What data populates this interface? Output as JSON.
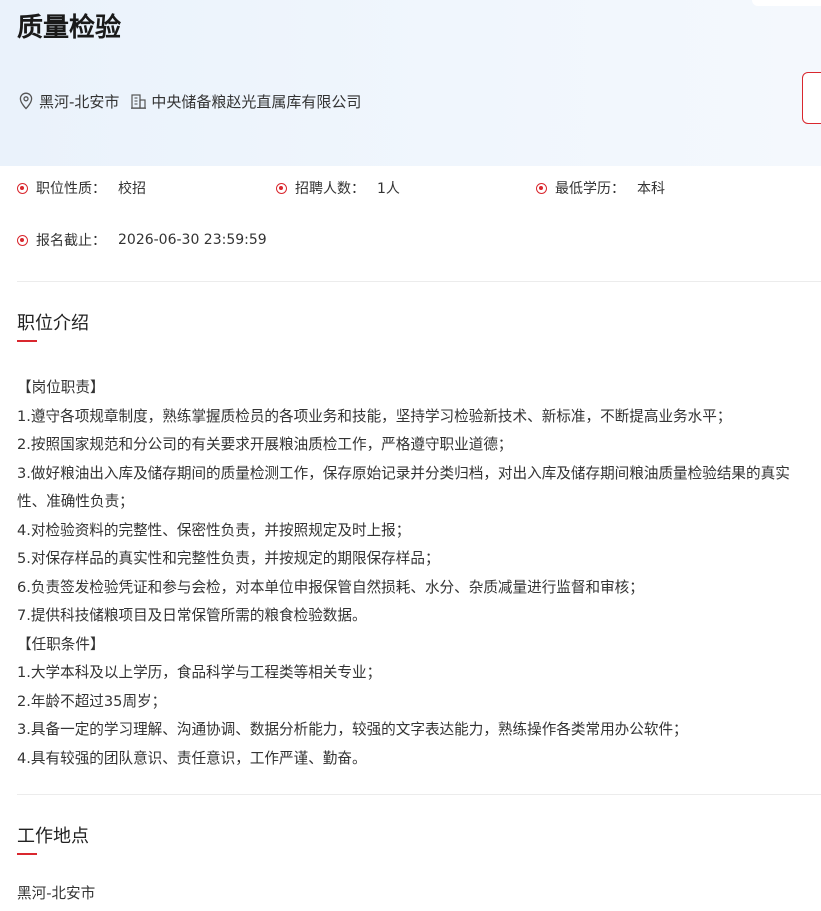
{
  "job": {
    "title": "质量检验",
    "location": "黑河-北安市",
    "company": "中央储备粮赵光直属库有限公司"
  },
  "attributes": [
    {
      "label": "职位性质：",
      "value": "校招"
    },
    {
      "label": "招聘人数：",
      "value": "1人"
    },
    {
      "label": "最低学历：",
      "value": "本科"
    },
    {
      "label": "报名截止：",
      "value": "2026-06-30 23:59:59"
    }
  ],
  "sections": {
    "intro_title": "职位介绍",
    "location_title": "工作地点"
  },
  "description": [
    "【岗位职责】",
    "1.遵守各项规章制度，熟练掌握质检员的各项业务和技能，坚持学习检验新技术、新标准，不断提高业务水平；",
    "2.按照国家规范和分公司的有关要求开展粮油质检工作，严格遵守职业道德；",
    "3.做好粮油出入库及储存期间的质量检测工作，保存原始记录并分类归档，对出入库及储存期间粮油质量检验结果的真实性、准确性负责；",
    "4.对检验资料的完整性、保密性负责，并按照规定及时上报；",
    "5.对保存样品的真实性和完整性负责，并按规定的期限保存样品；",
    "6.负责签发检验凭证和参与会检，对本单位申报保管自然损耗、水分、杂质减量进行监督和审核；",
    "7.提供科技储粮项目及日常保管所需的粮食检验数据。",
    "【任职条件】",
    "1.大学本科及以上学历，食品科学与工程类等相关专业；",
    "2.年龄不超过35周岁；",
    "3.具备一定的学习理解、沟通协调、数据分析能力，较强的文字表达能力，熟练操作各类常用办公软件；",
    "4.具有较强的团队意识、责任意识，工作严谨、勤奋。"
  ],
  "work_location": "黑河-北安市",
  "colors": {
    "accent": "#d9272e",
    "banner": "#eef5fc"
  },
  "icons": {
    "location": "location-pin-icon",
    "company": "building-icon",
    "attribute": "radio-dot-icon"
  }
}
